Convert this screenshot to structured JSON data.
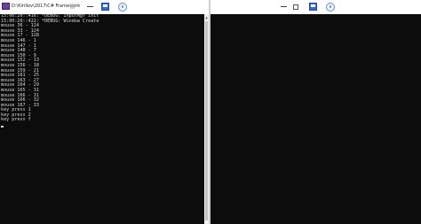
{
  "left_window": {
    "title": "D:\\Kirillov\\2017\\C# Framework",
    "icons": {
      "app": "console-app-icon",
      "dim": "grid-icon",
      "minimize": "minimize-icon",
      "save": "save-icon",
      "profile": "profile-icon"
    },
    "console_lines": [
      "15:00:20::416: *DEBUG: InputMgr init",
      "15:00:20::422: *DEBUG: Window Create",
      "mouse 36 - 124",
      "mouse 33 - 124",
      "mouse 17 - 128",
      "mouse 146 - 1",
      "mouse 147 - 1",
      "mouse 148 - 7",
      "mouse 150 - 9",
      "mouse 152 - 13",
      "mouse 156 - 18",
      "mouse 159 - 21",
      "mouse 161 - 25",
      "mouse 163 - 27",
      "mouse 164 - 29",
      "mouse 165 - 31",
      "mouse 166 - 31",
      "mouse 166 - 32",
      "mouse 167 - 33",
      "key press 1",
      "key press 2",
      "key press f"
    ]
  },
  "right_window": {
    "icons": {
      "minimize": "minimize-icon",
      "maximize": "maximize-icon",
      "square": "restore-icon",
      "save": "save-icon",
      "profile": "profile-icon"
    }
  },
  "colors": {
    "console_bg": "#0c0c0c",
    "console_text": "#d6d6d6",
    "accent_blue": "#3a68c8"
  }
}
